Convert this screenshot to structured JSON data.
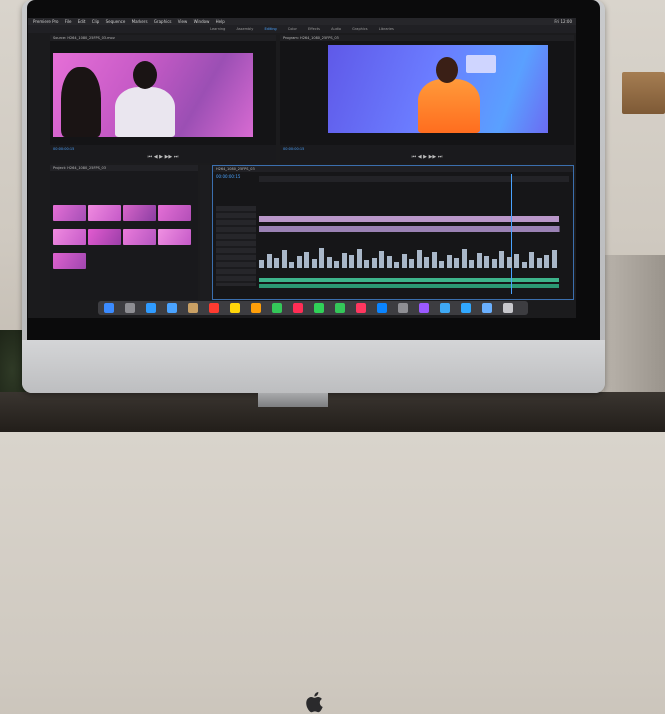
{
  "monitor_brand": "apple-logo",
  "menubar": {
    "app": "Premiere Pro",
    "items": [
      "File",
      "Edit",
      "Clip",
      "Sequence",
      "Markers",
      "Graphics",
      "View",
      "Window",
      "Help"
    ],
    "clock": "Fri 12:00"
  },
  "workspaces": {
    "items": [
      "Learning",
      "Assembly",
      "Editing",
      "Color",
      "Effects",
      "Audio",
      "Graphics",
      "Libraries"
    ],
    "active_index": 2
  },
  "source_monitor": {
    "clip_name": "Source: H264_1080_25FPS_03.mov"
  },
  "program_monitor": {
    "sequence_name": "Program: H264_1080_25FPS_03"
  },
  "project_panel": {
    "title": "Project: H264_1080_25FPS_03"
  },
  "timeline": {
    "sequence_name": "H264_1080_25FPS_03",
    "timecode": "00:00:00:15",
    "playhead_fraction": 0.84
  },
  "colors": {
    "accent": "#4aa3ff",
    "video_clip": "#9a82b4",
    "audio_clip": "#a9b7c8",
    "audio_track": "#3db38a",
    "source_frame": "#d66bd2",
    "program_frame": "#5f6aff"
  },
  "dock_icons": [
    "finder-icon",
    "launchpad-icon",
    "safari-icon",
    "mail-icon",
    "contacts-icon",
    "calendar-icon",
    "notes-icon",
    "reminders-icon",
    "maps-icon",
    "photos-icon",
    "messages-icon",
    "facetime-icon",
    "music-icon",
    "app-store-icon",
    "settings-icon",
    "premiere-icon",
    "lightroom-icon",
    "photoshop-icon",
    "finder-folder-icon",
    "trash-icon"
  ]
}
